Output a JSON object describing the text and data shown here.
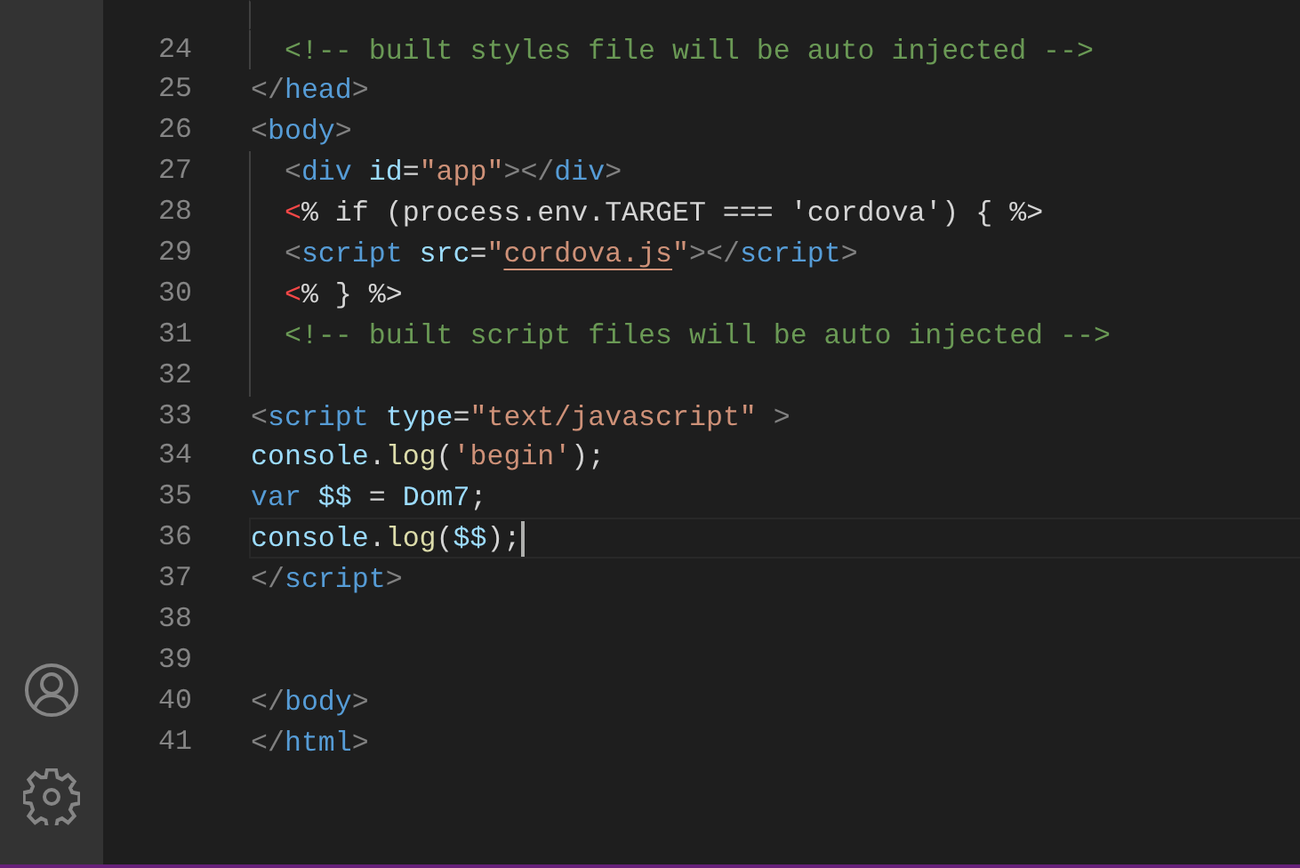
{
  "editor": {
    "lines": [
      {
        "number": "24",
        "indent_guide": true,
        "indented": true,
        "current": false,
        "tokens": [
          {
            "kind": "comment",
            "text": "<!-- built styles file will be auto injected -->"
          }
        ]
      },
      {
        "number": "25",
        "indent_guide": false,
        "indented": false,
        "current": false,
        "tokens": [
          {
            "kind": "punct",
            "text": "</"
          },
          {
            "kind": "tag",
            "text": "head"
          },
          {
            "kind": "punct",
            "text": ">"
          }
        ]
      },
      {
        "number": "26",
        "indent_guide": false,
        "indented": false,
        "current": false,
        "tokens": [
          {
            "kind": "punct",
            "text": "<"
          },
          {
            "kind": "tag",
            "text": "body"
          },
          {
            "kind": "punct",
            "text": ">"
          }
        ]
      },
      {
        "number": "27",
        "indent_guide": true,
        "indented": true,
        "current": false,
        "tokens": [
          {
            "kind": "punct",
            "text": "<"
          },
          {
            "kind": "tag",
            "text": "div"
          },
          {
            "kind": "attr",
            "text": "id",
            "gap_before": true
          },
          {
            "kind": "text",
            "text": "="
          },
          {
            "kind": "string",
            "text": "\"app\""
          },
          {
            "kind": "punct",
            "text": "></"
          },
          {
            "kind": "tag",
            "text": "div"
          },
          {
            "kind": "punct",
            "text": ">"
          }
        ]
      },
      {
        "number": "28",
        "indent_guide": true,
        "indented": true,
        "current": false,
        "tokens": [
          {
            "kind": "error",
            "text": "<"
          },
          {
            "kind": "text",
            "text": "% if (process.env.TARGET === 'cordova') { %>"
          }
        ]
      },
      {
        "number": "29",
        "indent_guide": true,
        "indented": true,
        "current": false,
        "tokens": [
          {
            "kind": "punct",
            "text": "<"
          },
          {
            "kind": "tag",
            "text": "script"
          },
          {
            "kind": "attr",
            "text": "src",
            "gap_before": true
          },
          {
            "kind": "text",
            "text": "="
          },
          {
            "kind": "string",
            "text": "\""
          },
          {
            "kind": "link",
            "text": "cordova.js"
          },
          {
            "kind": "string",
            "text": "\""
          },
          {
            "kind": "punct",
            "text": "></"
          },
          {
            "kind": "tag",
            "text": "script"
          },
          {
            "kind": "punct",
            "text": ">"
          }
        ]
      },
      {
        "number": "30",
        "indent_guide": true,
        "indented": true,
        "current": false,
        "tokens": [
          {
            "kind": "error",
            "text": "<"
          },
          {
            "kind": "text",
            "text": "% } %>"
          }
        ]
      },
      {
        "number": "31",
        "indent_guide": true,
        "indented": true,
        "current": false,
        "tokens": [
          {
            "kind": "comment",
            "text": "<!-- built script files will be auto injected -->"
          }
        ]
      },
      {
        "number": "32",
        "indent_guide": true,
        "current": false
      },
      {
        "number": "33",
        "indent_guide": false,
        "indented": false,
        "current": false,
        "tokens": [
          {
            "kind": "punct",
            "text": "<"
          },
          {
            "kind": "tag",
            "text": "script"
          },
          {
            "kind": "attr",
            "text": "type",
            "gap_before": true
          },
          {
            "kind": "text",
            "text": "="
          },
          {
            "kind": "string",
            "text": "\"text/javascript\""
          },
          {
            "kind": "punct",
            "text": ">",
            "gap_before": true
          }
        ]
      },
      {
        "number": "34",
        "indent_guide": false,
        "indented": false,
        "current": false,
        "tokens": [
          {
            "kind": "attr",
            "text": "console"
          },
          {
            "kind": "text",
            "text": "."
          },
          {
            "kind": "func",
            "text": "log"
          },
          {
            "kind": "text",
            "text": "("
          },
          {
            "kind": "string",
            "text": "'begin'"
          },
          {
            "kind": "text",
            "text": ");"
          }
        ]
      },
      {
        "number": "35",
        "indent_guide": false,
        "indented": false,
        "current": false,
        "tokens": [
          {
            "kind": "tag",
            "text": "var"
          },
          {
            "kind": "attr",
            "text": "$$",
            "gap_before": true
          },
          {
            "kind": "text",
            "text": "=",
            "gap_before": true
          },
          {
            "kind": "attr",
            "text": "Dom7",
            "gap_before": true
          },
          {
            "kind": "text",
            "text": ";"
          }
        ]
      },
      {
        "number": "36",
        "indent_guide": false,
        "indented": false,
        "current": true,
        "tokens": [
          {
            "kind": "attr",
            "text": "console"
          },
          {
            "kind": "text",
            "text": "."
          },
          {
            "kind": "func",
            "text": "log"
          },
          {
            "kind": "text",
            "text": "("
          },
          {
            "kind": "attr",
            "text": "$$"
          },
          {
            "kind": "text",
            "text": ");"
          }
        ]
      },
      {
        "number": "37",
        "indent_guide": false,
        "indented": false,
        "current": false,
        "tokens": [
          {
            "kind": "punct",
            "text": "</"
          },
          {
            "kind": "tag",
            "text": "script"
          },
          {
            "kind": "punct",
            "text": ">"
          }
        ]
      },
      {
        "number": "38",
        "indent_guide": false,
        "current": false
      },
      {
        "number": "39",
        "indent_guide": false,
        "current": false
      },
      {
        "number": "40",
        "indent_guide": false,
        "indented": false,
        "current": false,
        "tokens": [
          {
            "kind": "punct",
            "text": "</"
          },
          {
            "kind": "tag",
            "text": "body"
          },
          {
            "kind": "punct",
            "text": ">"
          }
        ]
      },
      {
        "number": "41",
        "indent_guide": false,
        "indented": false,
        "current": false,
        "tokens": [
          {
            "kind": "punct",
            "text": "</"
          },
          {
            "kind": "tag",
            "text": "html"
          },
          {
            "kind": "punct",
            "text": ">"
          }
        ]
      }
    ]
  }
}
